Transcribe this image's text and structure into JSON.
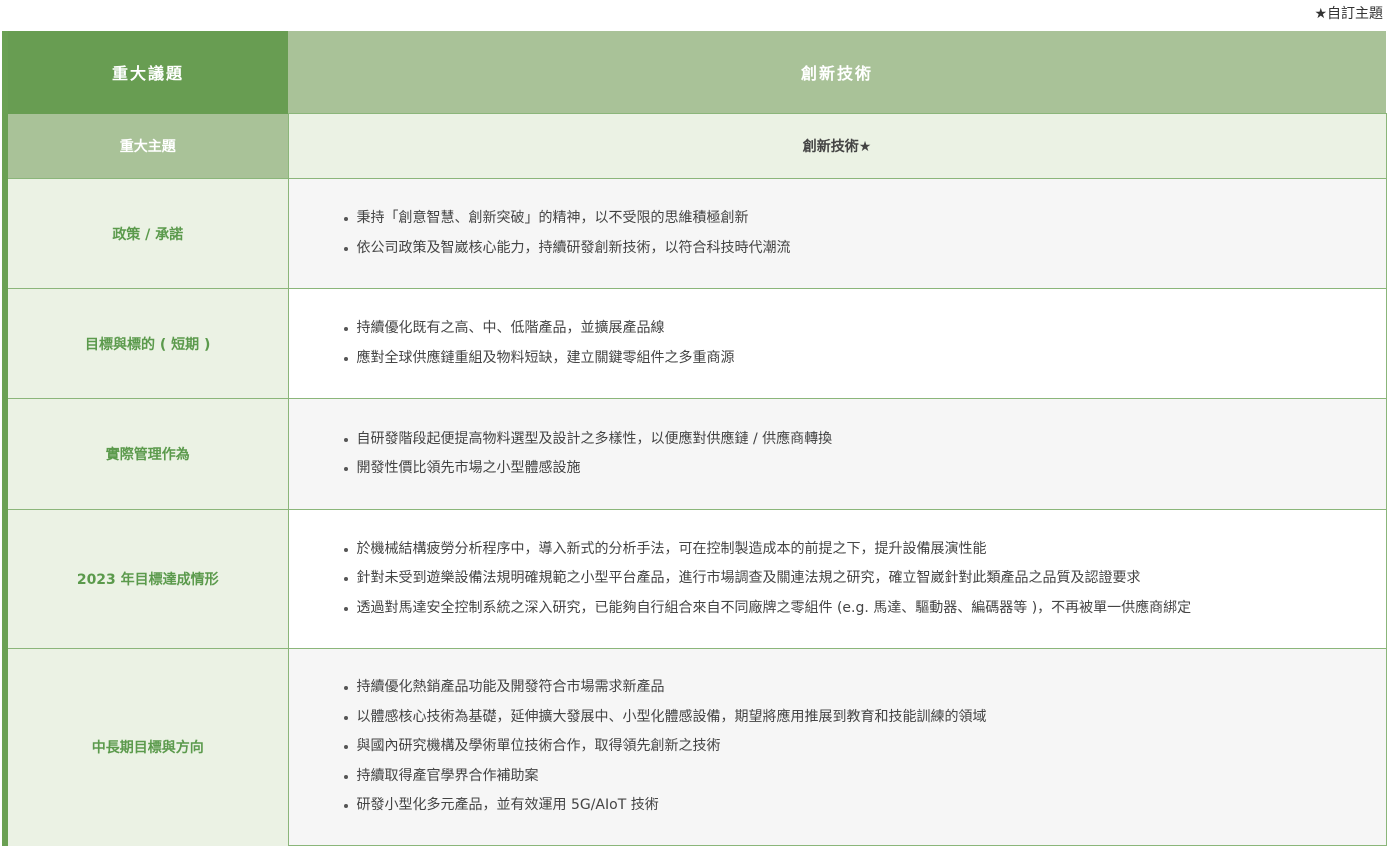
{
  "note": "★自訂主題",
  "header": {
    "col1": "重大議題",
    "col2": "創新技術"
  },
  "subheader": {
    "col1": "重大主題",
    "col2": "創新技術★"
  },
  "rows": [
    {
      "label": "政策 / 承諾",
      "items": [
        "秉持「創意智慧、創新突破」的精神，以不受限的思維積極創新",
        "依公司政策及智崴核心能力，持續研發創新技術，以符合科技時代潮流"
      ]
    },
    {
      "label": "目標與標的 ( 短期 )",
      "items": [
        "持續優化既有之高、中、低階產品，並擴展產品線",
        "應對全球供應鏈重組及物料短缺，建立關鍵零組件之多重商源"
      ]
    },
    {
      "label": "實際管理作為",
      "items": [
        "自研發階段起便提高物料選型及設計之多樣性，以便應對供應鏈 / 供應商轉換",
        "開發性價比領先市場之小型體感設施"
      ]
    },
    {
      "label": "2023 年目標達成情形",
      "items": [
        "於機械結構疲勞分析程序中，導入新式的分析手法，可在控制製造成本的前提之下，提升設備展演性能",
        "針對未受到遊樂設備法規明確規範之小型平台產品，進行市場調查及關連法規之研究，確立智崴針對此類產品之品質及認證要求",
        "透過對馬達安全控制系統之深入研究，已能夠自行組合來自不同廠牌之零組件 (e.g. 馬達、驅動器、編碼器等 )，不再被單一供應商綁定"
      ]
    },
    {
      "label": "中長期目標與方向",
      "items": [
        "持續優化熱銷產品功能及開發符合市場需求新產品",
        "以體感核心技術為基礎，延伸擴大發展中、小型化體感設備，期望將應用推展到教育和技能訓練的領域",
        "與國內研究機構及學術單位技術合作，取得領先創新之技術",
        "持續取得產官學界合作補助案",
        "研發小型化多元產品，並有效運用 5G/AIoT 技術"
      ]
    }
  ]
}
